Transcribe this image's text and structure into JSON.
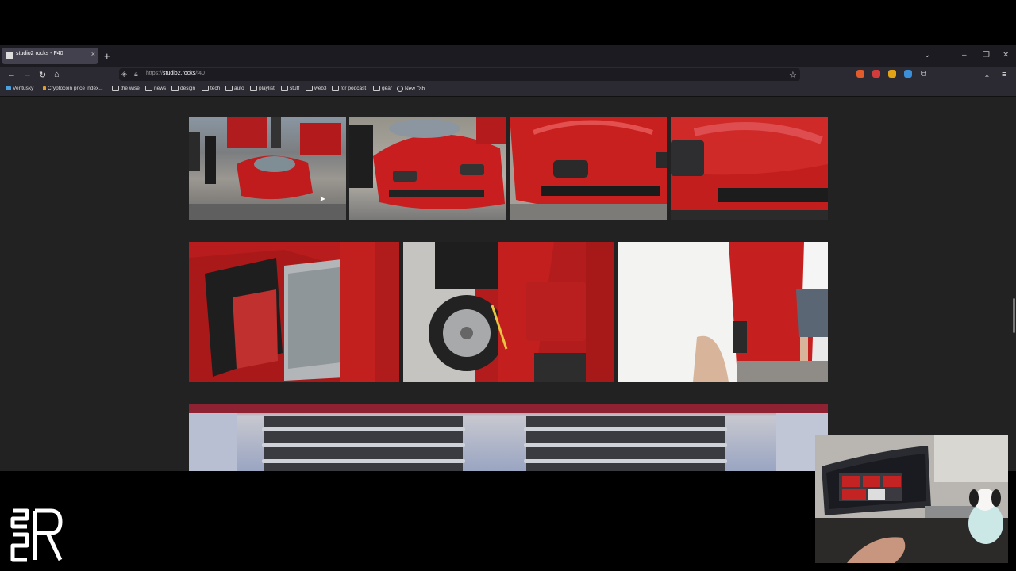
{
  "browser": {
    "tab_title": "studio2 rocks - F40",
    "tab_close": "×",
    "new_tab": "+",
    "url_prefix": "https://",
    "url_host": "studio2.rocks",
    "url_path": "/f40",
    "bookmarks": [
      "Ventusky",
      "Cryptocoin price index...",
      "the wise",
      "news",
      "design",
      "tech",
      "auto",
      "playlist",
      "stuff",
      "web3",
      "for podcast",
      "gear",
      "New Tab"
    ],
    "accent": "#2b2a33"
  },
  "icons": {
    "back": "arrow-left-icon",
    "forward": "arrow-right-icon",
    "reload": "reload-icon",
    "home": "home-icon",
    "shield": "shield-icon",
    "lock": "lock-icon",
    "star": "star-icon",
    "download": "download-icon",
    "menu": "hamburger-menu-icon"
  },
  "gallery": {
    "row1": [
      "f40-crowd-front",
      "f40-front-left",
      "f40-hood-front",
      "f40-nose-closeup"
    ],
    "row2": [
      "f40-door-interior",
      "f40-side-wheel",
      "f40-person-rear"
    ],
    "row3": [
      "f40-rear-louvres"
    ]
  },
  "watermark": "S2R"
}
